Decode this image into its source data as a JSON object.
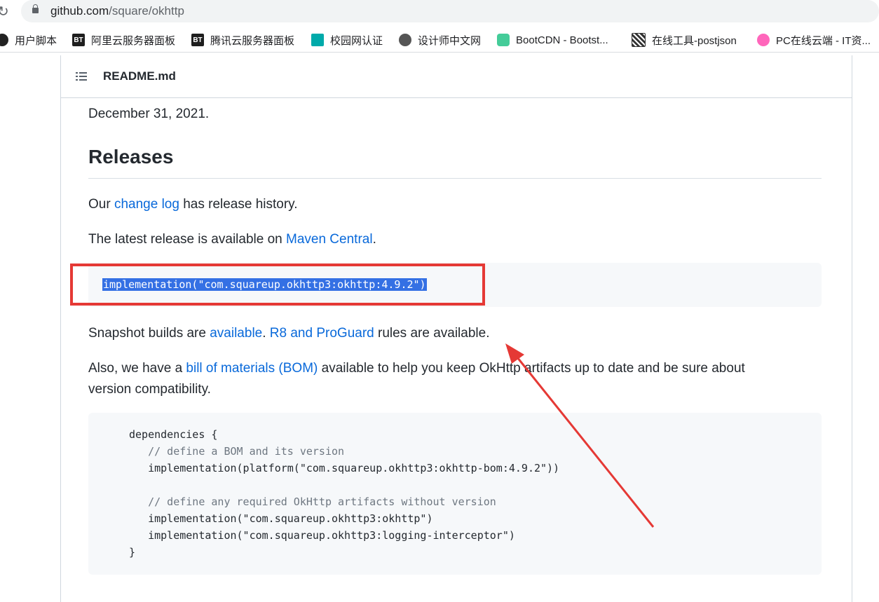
{
  "browser": {
    "url_host": "github.com",
    "url_path": "/square/okhttp"
  },
  "bookmarks": [
    {
      "label": "用户脚本",
      "icon": "user-script-icon"
    },
    {
      "label": "阿里云服务器面板",
      "icon": "bt-icon",
      "badge": "BT"
    },
    {
      "label": "腾讯云服务器面板",
      "icon": "bt-icon",
      "badge": "BT"
    },
    {
      "label": "校园网认证",
      "icon": "campus-icon"
    },
    {
      "label": "设计师中文网",
      "icon": "globe-icon"
    },
    {
      "label": "BootCDN - Bootst...",
      "icon": "bootcdn-icon"
    },
    {
      "label": "在线工具-postjson",
      "icon": "qr-icon"
    },
    {
      "label": "PC在线云端 - IT资...",
      "icon": "avatar-icon"
    }
  ],
  "readme": {
    "title": "README.md",
    "top_line": "December 31, 2021.",
    "releases_heading": "Releases",
    "changelog_pre": "Our ",
    "changelog_link": "change log",
    "changelog_post": " has release history.",
    "latest_pre": "The latest release is available on ",
    "latest_link": "Maven Central",
    "latest_post": ".",
    "impl_code": "implementation(\"com.squareup.okhttp3:okhttp:4.9.2\")",
    "snapshot_pre": "Snapshot builds are ",
    "snapshot_link": "available",
    "snapshot_mid": ". ",
    "proguard_link": "R8 and ProGuard",
    "snapshot_post": " rules are available.",
    "bom_pre": "Also, we have a ",
    "bom_link": "bill of materials (BOM)",
    "bom_post": " available to help you keep OkHttp artifacts up to date and be sure about",
    "bom_line2": "version compatibility.",
    "deps_code": [
      "dependencies {",
      "   // define a BOM and its version",
      "   implementation(platform(\"com.squareup.okhttp3:okhttp-bom:4.9.2\"))",
      "",
      "   // define any required OkHttp artifacts without version",
      "   implementation(\"com.squareup.okhttp3:okhttp\")",
      "   implementation(\"com.squareup.okhttp3:logging-interceptor\")",
      "}"
    ]
  },
  "annotation_colors": {
    "highlight_box": "#e53935",
    "arrow": "#e53935",
    "selection": "#3470e4"
  }
}
